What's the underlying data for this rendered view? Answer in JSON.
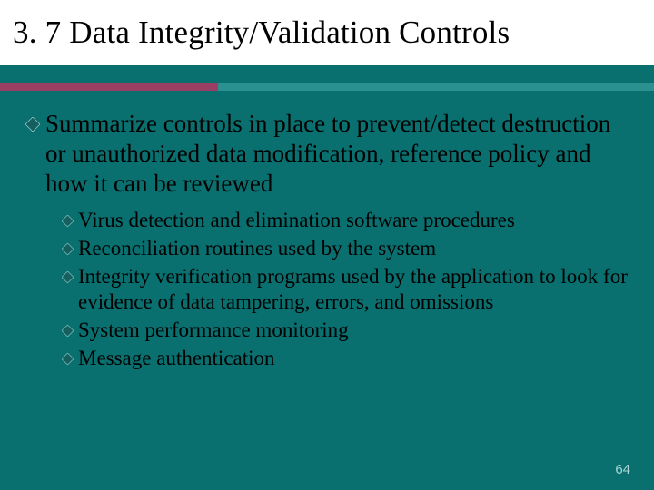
{
  "slide": {
    "title": "3. 7  Data Integrity/Validation Controls",
    "pageNumber": "64"
  },
  "bullets": {
    "main": {
      "text": "Summarize controls in place to prevent/detect destruction or unauthorized data modification, reference policy and how it can be reviewed"
    },
    "subs": [
      {
        "text": "Virus detection and elimination software procedures"
      },
      {
        "text": "Reconciliation routines used by the system"
      },
      {
        "text": "Integrity verification programs used by the application to look for evidence of data tampering, errors, and omissions"
      },
      {
        "text": "System performance monitoring"
      },
      {
        "text": "Message authentication"
      }
    ]
  },
  "colors": {
    "background": "#0a6f6f",
    "ruleLeft": "#9b3e64",
    "ruleRight": "#2d9090",
    "bulletFill": "#165f5f",
    "bulletEdge": "#9ad3d3"
  }
}
